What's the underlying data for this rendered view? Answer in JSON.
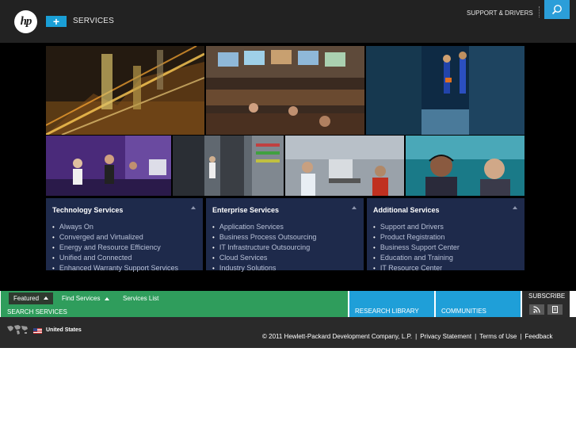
{
  "header": {
    "logo_text": "hp",
    "menu_button": "+",
    "section_label": "SERVICES",
    "support_link": "SUPPORT & DRIVERS",
    "search_icon": "search-icon"
  },
  "panels": [
    {
      "title": "Technology Services",
      "items": [
        "Always On",
        "Converged and Virtualized",
        "Energy and Resource Efficiency",
        "Unified and Connected",
        "Enhanced Warranty Support Services"
      ]
    },
    {
      "title": "Enterprise Services",
      "items": [
        "Application Services",
        "Business Process Outsourcing",
        "IT Infrastructure Outsourcing",
        "Cloud Services",
        "Industry Solutions"
      ]
    },
    {
      "title": "Additional Services",
      "items": [
        "Support and Drivers",
        "Product Registration",
        "Business Support Center",
        "Education and Training",
        "IT Resource Center"
      ]
    }
  ],
  "tabs": {
    "featured": "Featured",
    "find_services": "Find Services",
    "services_list": "Services List",
    "search_services": "SEARCH SERVICES",
    "research_library": "RESEARCH LIBRARY",
    "communities": "COMMUNITIES",
    "subscribe": "SUBSCRIBE",
    "rss_icon": "rss-icon",
    "mobile_icon": "mobile-icon"
  },
  "footer": {
    "country": "United States",
    "copyright": "© 2011 Hewlett-Packard Development Company, L.P.",
    "privacy": "Privacy Statement",
    "terms": "Terms of Use",
    "feedback": "Feedback"
  },
  "colors": {
    "accent_blue": "#1f9fd8",
    "accent_green": "#2f9d5c",
    "panel_navy": "#1e2a4b"
  }
}
